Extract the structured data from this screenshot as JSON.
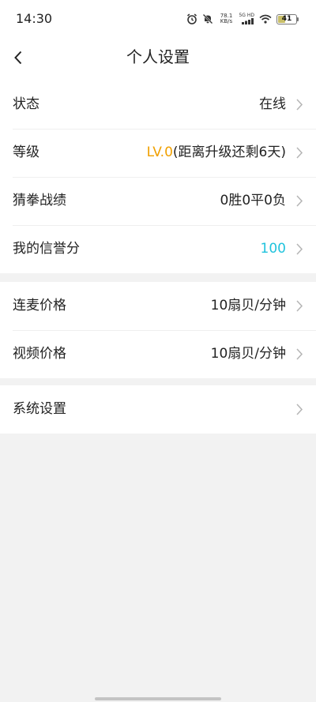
{
  "status_bar": {
    "time": "14:30",
    "net_speed_value": "78.1",
    "net_speed_unit": "KB/s",
    "network_type": "5G HD",
    "battery_level": "41",
    "icons": [
      "alarm-icon",
      "mute-icon",
      "signal-icon",
      "wifi-icon",
      "battery-icon"
    ]
  },
  "header": {
    "title": "个人设置"
  },
  "colors": {
    "accent_level": "#f0a000",
    "accent_score": "#21c3dd",
    "background": "#f2f2f2"
  },
  "sections": [
    {
      "rows": [
        {
          "label": "状态",
          "value": "在线"
        },
        {
          "label": "等级",
          "value_highlight": "LV.0",
          "value_rest": "(距离升级还剩6天)"
        },
        {
          "label": "猜拳战绩",
          "value": "0胜0平0负"
        },
        {
          "label": "我的信誉分",
          "value": "100"
        }
      ]
    },
    {
      "rows": [
        {
          "label": "连麦价格",
          "value": "10扇贝/分钟"
        },
        {
          "label": "视频价格",
          "value": "10扇贝/分钟"
        }
      ]
    },
    {
      "rows": [
        {
          "label": "系统设置",
          "value": ""
        }
      ]
    }
  ]
}
